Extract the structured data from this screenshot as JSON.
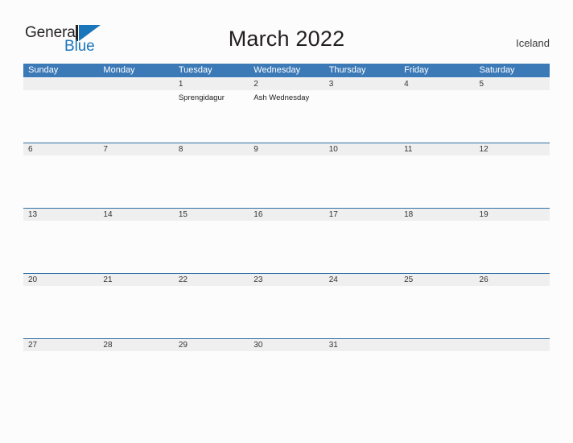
{
  "brand": {
    "name_part1": "General",
    "name_part2": "Blue",
    "mark": "flag-triangle"
  },
  "header": {
    "title": "March 2022",
    "country": "Iceland"
  },
  "colors": {
    "header_blue": "#3b79b7",
    "rule_blue": "#2e6da4",
    "date_strip_gray": "#efefef",
    "logo_blue": "#1b75bb",
    "page_background": "#fcfcfc"
  },
  "weekdays": [
    "Sunday",
    "Monday",
    "Tuesday",
    "Wednesday",
    "Thursday",
    "Friday",
    "Saturday"
  ],
  "weeks": [
    {
      "days": [
        {
          "date": "",
          "events": []
        },
        {
          "date": "",
          "events": []
        },
        {
          "date": "1",
          "events": [
            "Sprengidagur"
          ]
        },
        {
          "date": "2",
          "events": [
            "Ash Wednesday"
          ]
        },
        {
          "date": "3",
          "events": []
        },
        {
          "date": "4",
          "events": []
        },
        {
          "date": "5",
          "events": []
        }
      ]
    },
    {
      "days": [
        {
          "date": "6",
          "events": []
        },
        {
          "date": "7",
          "events": []
        },
        {
          "date": "8",
          "events": []
        },
        {
          "date": "9",
          "events": []
        },
        {
          "date": "10",
          "events": []
        },
        {
          "date": "11",
          "events": []
        },
        {
          "date": "12",
          "events": []
        }
      ]
    },
    {
      "days": [
        {
          "date": "13",
          "events": []
        },
        {
          "date": "14",
          "events": []
        },
        {
          "date": "15",
          "events": []
        },
        {
          "date": "16",
          "events": []
        },
        {
          "date": "17",
          "events": []
        },
        {
          "date": "18",
          "events": []
        },
        {
          "date": "19",
          "events": []
        }
      ]
    },
    {
      "days": [
        {
          "date": "20",
          "events": []
        },
        {
          "date": "21",
          "events": []
        },
        {
          "date": "22",
          "events": []
        },
        {
          "date": "23",
          "events": []
        },
        {
          "date": "24",
          "events": []
        },
        {
          "date": "25",
          "events": []
        },
        {
          "date": "26",
          "events": []
        }
      ]
    },
    {
      "days": [
        {
          "date": "27",
          "events": []
        },
        {
          "date": "28",
          "events": []
        },
        {
          "date": "29",
          "events": []
        },
        {
          "date": "30",
          "events": []
        },
        {
          "date": "31",
          "events": []
        },
        {
          "date": "",
          "events": []
        },
        {
          "date": "",
          "events": []
        }
      ]
    }
  ]
}
